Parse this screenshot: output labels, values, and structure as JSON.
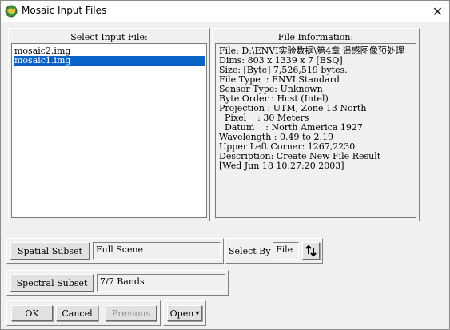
{
  "window": {
    "title": "Mosaic Input Files",
    "app_icon": "envi-globe-icon",
    "close_glyph": "✕"
  },
  "input_list": {
    "title": "Select Input File:",
    "items": [
      "mosaic2.img",
      "mosaic1.img"
    ],
    "selected_index": 1
  },
  "file_info": {
    "title": "File Information:",
    "lines": [
      "File: D:\\ENVI实验数据\\第4章 遥感图像预处理",
      "Dims: 803 x 1339 x 7 [BSQ]",
      "Size: [Byte] 7,526,519 bytes.",
      "File Type  : ENVI Standard",
      "Sensor Type: Unknown",
      "Byte Order : Host (Intel)",
      "Projection : UTM, Zone 13 North",
      "  Pixel    : 30 Meters",
      "  Datum    : North America 1927",
      "Wavelength : 0.49 to 2.19",
      "Upper Left Corner: 1267,2230",
      "Description: Create New File Result",
      "[Wed Jun 18 10:27:20 2003]"
    ]
  },
  "spatial_subset": {
    "button_label": "Spatial Subset",
    "value": "Full Scene"
  },
  "select_by": {
    "label": "Select By",
    "value": "File",
    "toggle_icon": "sort-arrows-icon"
  },
  "spectral_subset": {
    "button_label": "Spectral Subset",
    "value": "7/7 Bands"
  },
  "actions": {
    "ok_label": "OK",
    "cancel_label": "Cancel",
    "previous_label": "Previous",
    "open_label": "Open",
    "open_arrow": "▾"
  }
}
